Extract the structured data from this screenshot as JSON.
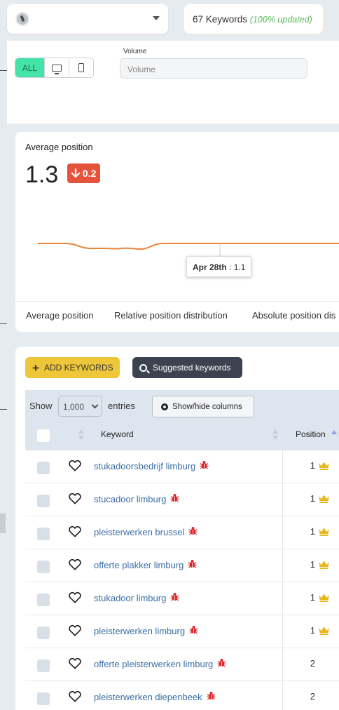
{
  "site_selector": {
    "value": ""
  },
  "keywords_summary": {
    "count_text": "67 Keywords",
    "updated_text": "(100% updated)"
  },
  "device_filter": {
    "all_label": "ALL",
    "desktop_icon": "monitor-icon",
    "mobile_icon": "phone-icon",
    "active": "ALL"
  },
  "volume_filter": {
    "label": "Volume",
    "placeholder": "Volume"
  },
  "avg_position": {
    "title": "Average position",
    "value": "1.3",
    "delta": "0.2",
    "delta_direction": "down",
    "tooltip_date": "Apr 28th",
    "tooltip_value": ": 1.1",
    "line_color": "#e8863a"
  },
  "chart_tabs": [
    "Average position",
    "Relative position distribution",
    "Absolute position dis"
  ],
  "actions": {
    "add_keywords": "ADD KEYWORDS",
    "suggested_keywords": "Suggested keywords"
  },
  "table_controls": {
    "show_label": "Show",
    "page_length": "1,000",
    "entries_label": "entries",
    "columns_button": "Show/hide columns"
  },
  "table_header": {
    "keyword": "Keyword",
    "position": "Position"
  },
  "rows": [
    {
      "keyword": "stukadoorsbedrijf limburg",
      "position": "1",
      "crown": true
    },
    {
      "keyword": "stucadoor limburg",
      "position": "1",
      "crown": true
    },
    {
      "keyword": "pleisterwerken brussel",
      "position": "1",
      "crown": true
    },
    {
      "keyword": "offerte plakker limburg",
      "position": "1",
      "crown": true
    },
    {
      "keyword": "stukadoor limburg",
      "position": "1",
      "crown": true
    },
    {
      "keyword": "pleisterwerken limburg",
      "position": "1",
      "crown": true
    },
    {
      "keyword": "offerte pleisterwerken limburg",
      "position": "2",
      "crown": false
    },
    {
      "keyword": "pleisterwerken diepenbeek",
      "position": "2",
      "crown": false
    }
  ],
  "colors": {
    "accent_green": "#44e3a7",
    "add_yellow": "#eec63a",
    "dark_button": "#3c4250",
    "delta_red": "#e5533c",
    "link_blue": "#3a6ea5",
    "crown_gold": "#e7b820",
    "bug_red": "#d9262b"
  }
}
